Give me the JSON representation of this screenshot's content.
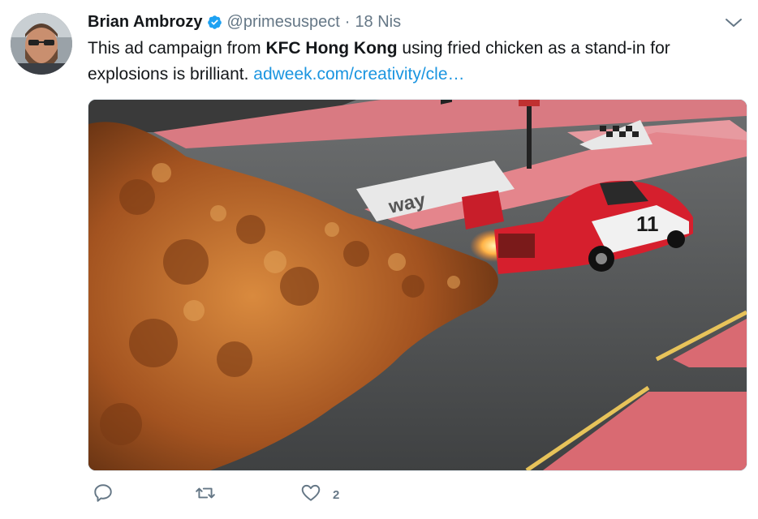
{
  "tweet": {
    "author_name": "Brian Ambrozy",
    "handle": "@primesuspect",
    "separator": "·",
    "date": "18 Nis",
    "text_part1": "This ad campaign from ",
    "text_bold": "KFC Hong Kong",
    "text_part2": " using fried chicken as a stand-in for explosions is brilliant. ",
    "link_text": "adweek.com/creativity/cle…"
  },
  "media": {
    "billboard_text": "way",
    "car_number": "11"
  },
  "actions": {
    "like_count": "2"
  },
  "colors": {
    "link": "#1b95e0",
    "secondary_text": "#657786",
    "verified": "#1da1f2",
    "icon": "#657786"
  }
}
